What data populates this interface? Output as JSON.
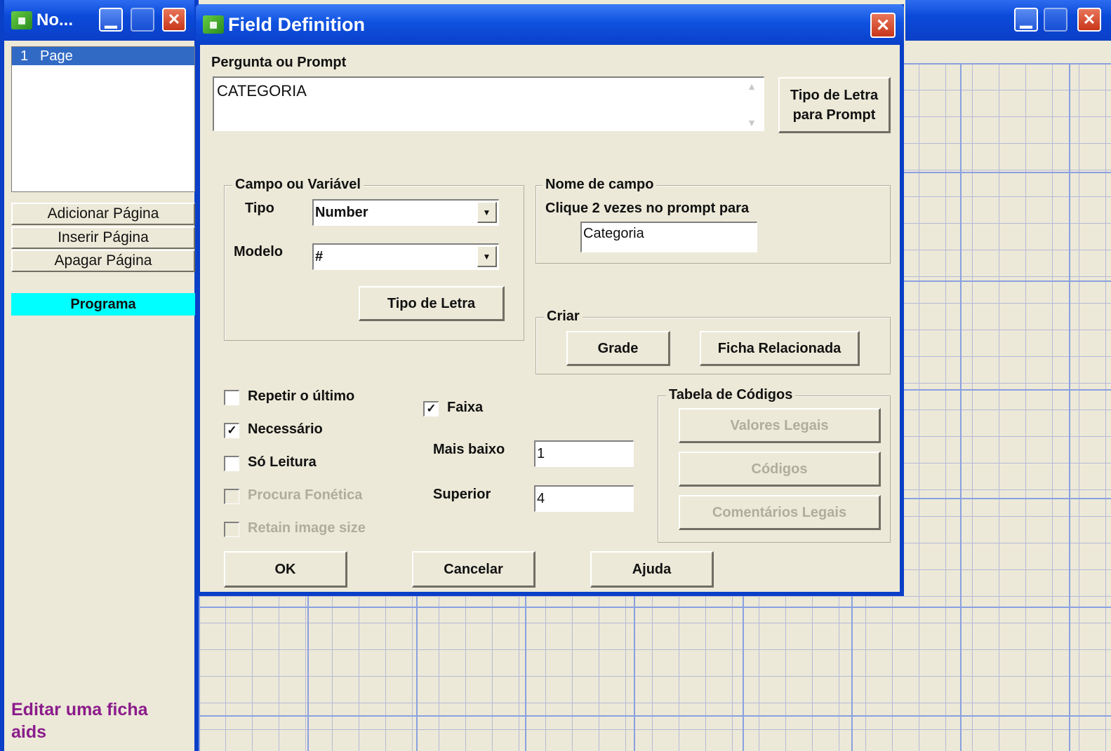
{
  "left_window": {
    "title": "No...",
    "page_list": [
      {
        "num": "1",
        "label": "Page"
      }
    ],
    "buttons": {
      "add": "Adicionar Página",
      "insert": "Inserir Página",
      "delete": "Apagar Página",
      "program": "Programa"
    },
    "status": {
      "line1": "Editar uma ficha",
      "line2": "aids"
    }
  },
  "dialog": {
    "title": "Field Definition",
    "prompt_label": "Pergunta ou Prompt",
    "prompt_value": "CATEGORIA",
    "prompt_font_button": "Tipo de Letra para Prompt",
    "field_group": {
      "title": "Campo ou Variável",
      "type_label": "Tipo",
      "type_value": "Number",
      "model_label": "Modelo",
      "model_value": "#",
      "font_button": "Tipo de Letra"
    },
    "name_group": {
      "title": "Nome de campo",
      "hint": "Clique 2 vezes no prompt para",
      "value": "Categoria"
    },
    "create_group": {
      "title": "Criar",
      "grid_button": "Grade",
      "related_button": "Ficha Relacionada"
    },
    "checkboxes": {
      "repeat_last": {
        "label": "Repetir o último",
        "checked": false
      },
      "required": {
        "label": "Necessário",
        "checked": true
      },
      "read_only": {
        "label": "Só Leitura",
        "checked": false
      },
      "phonetic": {
        "label": "Procura Fonética",
        "checked": false,
        "disabled": true
      },
      "retain_image": {
        "label": "Retain image size",
        "checked": false,
        "disabled": true
      },
      "range": {
        "label": "Faixa",
        "checked": true
      }
    },
    "range": {
      "lower_label": "Mais baixo",
      "lower_value": "1",
      "upper_label": "Superior",
      "upper_value": "4"
    },
    "codes_group": {
      "title": "Tabela de Códigos",
      "legal_values": "Valores Legais",
      "codes": "Códigos",
      "legal_comments": "Comentários Legais"
    },
    "footer": {
      "ok": "OK",
      "cancel": "Cancelar",
      "help": "Ajuda"
    }
  },
  "colors": {
    "titlebar": "#0a3fc8",
    "face": "#ece9d8",
    "selected": "#316ac5",
    "program_bg": "#00ffff",
    "status_text": "#8b1c8b"
  }
}
